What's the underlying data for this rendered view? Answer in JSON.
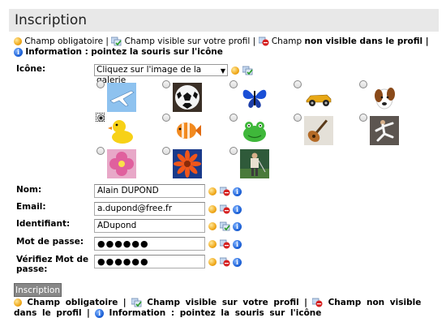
{
  "page": {
    "title": "Inscription"
  },
  "legend": {
    "required": "Champ obligatoire |",
    "visible": "Champ visible sur votre profil |",
    "hidden_prefix": "Champ ",
    "hidden_bold": "non visible dans le profil",
    "hidden_sep": " |",
    "info_bold": "Information :",
    "info_text": "pointez la souris sur l'icône"
  },
  "legend_bottom": {
    "required": "Champ obligatoire",
    "visible": "Champ visible sur votre profil",
    "hidden": "Champ non visible dans le profil",
    "info": "Information : pointez la souris sur l'icône",
    "sep": "|"
  },
  "icon_field": {
    "label": "Icône:",
    "select_value": "Cliquez sur l'image de la galerie",
    "gallery": [
      {
        "name": "plane",
        "checked": false
      },
      {
        "name": "soccer-ball",
        "checked": false
      },
      {
        "name": "butterfly",
        "checked": false
      },
      {
        "name": "race-car",
        "checked": false
      },
      {
        "name": "dog",
        "checked": false
      },
      {
        "name": "duck",
        "checked": true
      },
      {
        "name": "fish",
        "checked": false
      },
      {
        "name": "frog",
        "checked": false
      },
      {
        "name": "guitar",
        "checked": false
      },
      {
        "name": "karate",
        "checked": false
      },
      {
        "name": "flower-pink",
        "checked": false
      },
      {
        "name": "flower-orange",
        "checked": false
      },
      {
        "name": "golfer",
        "checked": false
      }
    ]
  },
  "fields": {
    "nom": {
      "label": "Nom:",
      "value": "Alain DUPOND"
    },
    "email": {
      "label": "Email:",
      "value": "a.dupond@free.fr"
    },
    "identifiant": {
      "label": "Identifiant:",
      "value": "ADupond"
    },
    "password": {
      "label": "Mot de passe:",
      "value": "●●●●●●"
    },
    "password_confirm": {
      "label_line1": "Vérifiez Mot de",
      "label_line2": "passe:",
      "value": "●●●●●●"
    }
  },
  "submit_label": "Inscription",
  "icons": {
    "required": "required-bullet-icon",
    "visible": "visible-profile-icon",
    "hidden": "hidden-profile-icon",
    "info": "info-icon"
  },
  "colors": {
    "title_bar": "#e8e8e8",
    "button": "#888888",
    "info": "#1a5fd6",
    "required": "#f0a81a"
  }
}
